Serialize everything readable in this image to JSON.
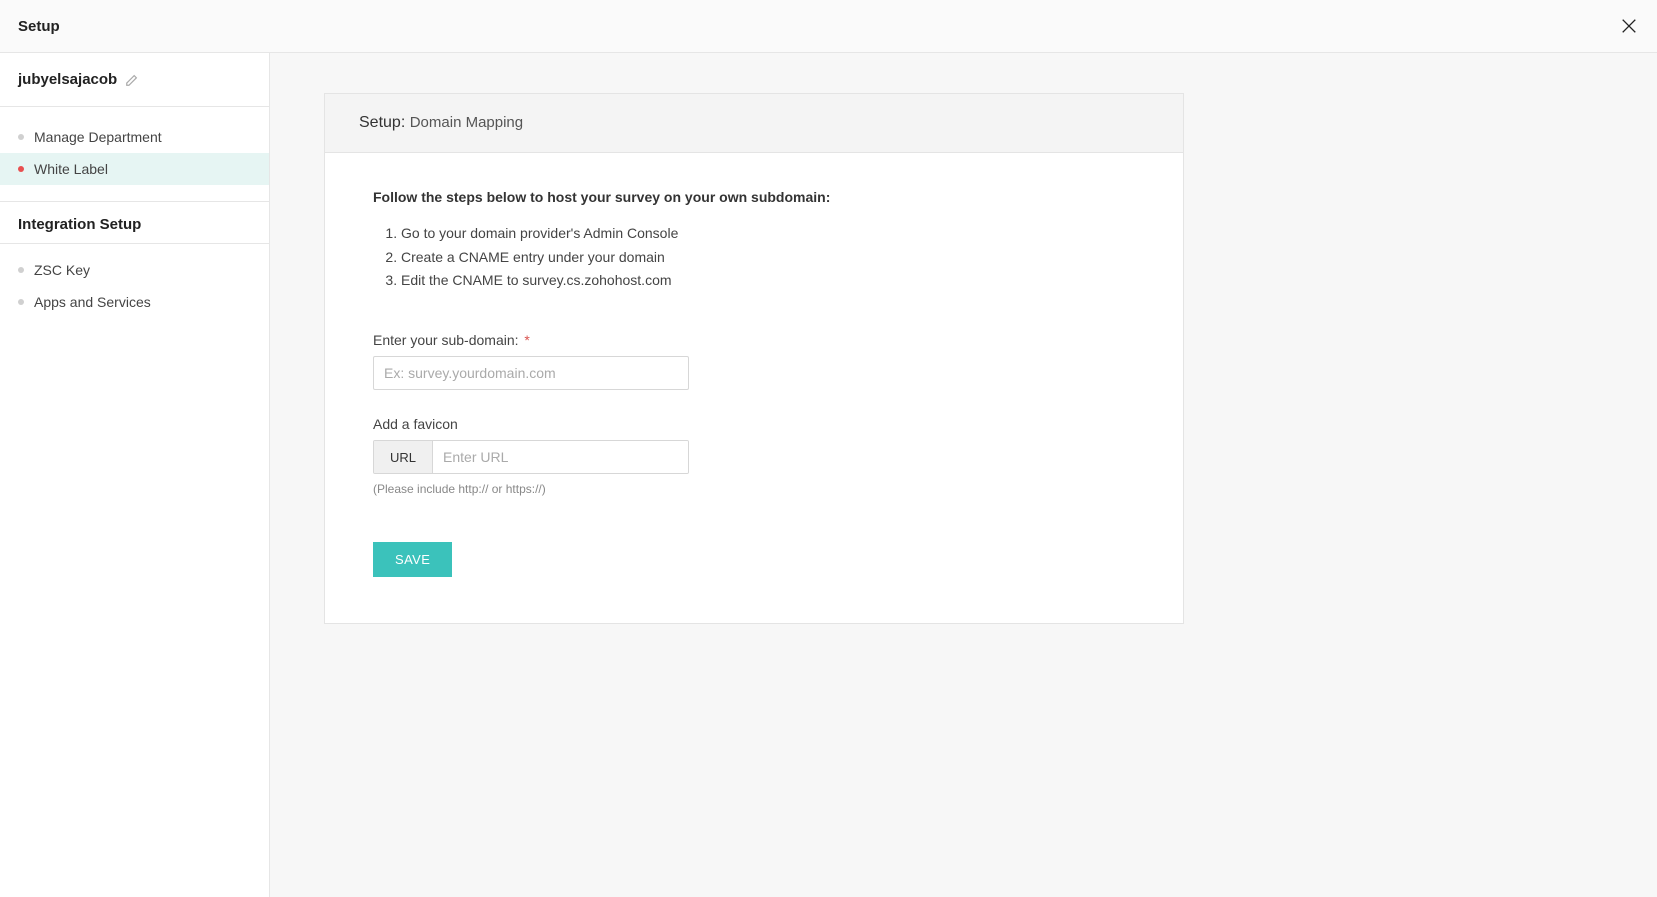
{
  "topbar": {
    "title": "Setup"
  },
  "sidebar": {
    "username": "jubyelsajacob",
    "items": [
      {
        "label": "Manage Department",
        "active": false
      },
      {
        "label": "White Label",
        "active": true
      }
    ],
    "section_heading": "Integration Setup",
    "secondary_items": [
      {
        "label": "ZSC Key"
      },
      {
        "label": "Apps and Services"
      }
    ]
  },
  "card": {
    "header_prefix": "Setup:",
    "header_suffix": "Domain Mapping",
    "instructions_title": "Follow the steps below to host your survey on your own subdomain:",
    "steps": [
      "Go to your domain provider's Admin Console",
      "Create a CNAME entry under your domain",
      "Edit the CNAME to survey.cs.zohohost.com"
    ],
    "subdomain": {
      "label": "Enter your sub-domain:",
      "required_mark": "*",
      "placeholder": "Ex: survey.yourdomain.com",
      "value": ""
    },
    "favicon": {
      "label": "Add a favicon",
      "addon": "URL",
      "placeholder": "Enter URL",
      "value": "",
      "hint": "(Please include http:// or https://)"
    },
    "save_label": "SAVE"
  }
}
